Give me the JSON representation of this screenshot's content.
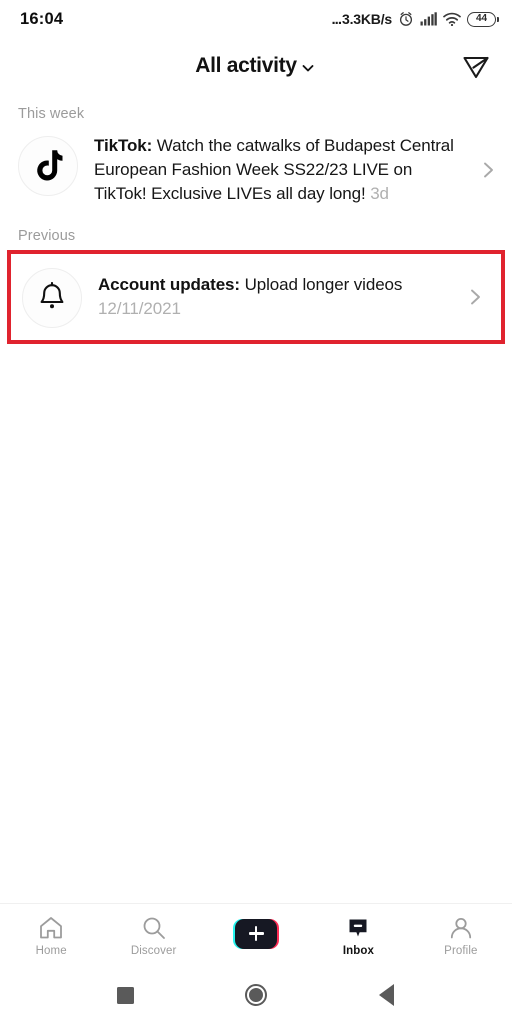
{
  "status_bar": {
    "clock": "16:04",
    "network_speed": "3.3KB/s",
    "leading_dots": "...",
    "battery_level": "44",
    "icons": [
      "alarm-clock-icon",
      "signal-bars-icon",
      "wifi-icon",
      "battery-icon"
    ]
  },
  "header": {
    "title": "All activity",
    "dropdown_icon": "chevron-down-icon",
    "send_icon": "send-message-icon"
  },
  "sections": [
    {
      "label": "This week",
      "items": [
        {
          "avatar_icon": "tiktok-logo-icon",
          "title": "TikTok:",
          "text": " Watch the catwalks of Budapest Central European Fashion Week SS22/23 LIVE on TikTok! Exclusive LIVEs all day long! ",
          "time": "3d",
          "chevron": "chevron-right-icon",
          "highlighted": false
        }
      ]
    },
    {
      "label": "Previous",
      "items": [
        {
          "avatar_icon": "bell-icon",
          "title": "Account updates:",
          "text": " Upload longer videos ",
          "time": "12/11/2021",
          "chevron": "chevron-right-icon",
          "highlighted": true
        }
      ]
    }
  ],
  "highlight": {
    "color": "#e0232e"
  },
  "tab_bar": {
    "tabs": [
      {
        "label": "Home",
        "icon": "home-icon",
        "active": false
      },
      {
        "label": "Discover",
        "icon": "search-icon",
        "active": false
      },
      {
        "label": "",
        "icon": "create-plus-icon",
        "active": false
      },
      {
        "label": "Inbox",
        "icon": "inbox-message-icon",
        "active": true
      },
      {
        "label": "Profile",
        "icon": "person-icon",
        "active": false
      }
    ],
    "create_colors": {
      "cyan": "#25f4ee",
      "pink": "#fe2c55",
      "core": "#161823"
    }
  },
  "android_nav": {
    "recents_icon": "square-recents-icon",
    "home_icon": "circle-home-icon",
    "back_icon": "triangle-back-icon"
  }
}
